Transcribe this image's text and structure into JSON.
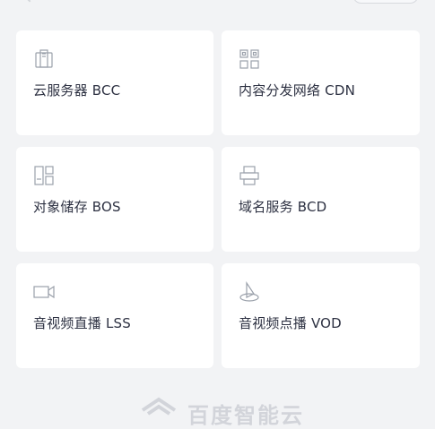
{
  "services": [
    {
      "label": "云服务器 BCC",
      "icon": "server-icon"
    },
    {
      "label": "内容分发网络 CDN",
      "icon": "cdn-grid-icon"
    },
    {
      "label": "对象储存 BOS",
      "icon": "storage-icon"
    },
    {
      "label": "域名服务 BCD",
      "icon": "domain-icon"
    },
    {
      "label": "音视频直播 LSS",
      "icon": "video-camera-icon"
    },
    {
      "label": "音视频点播 VOD",
      "icon": "play-cone-icon"
    }
  ],
  "footer": {
    "brand": "百度智能云"
  }
}
